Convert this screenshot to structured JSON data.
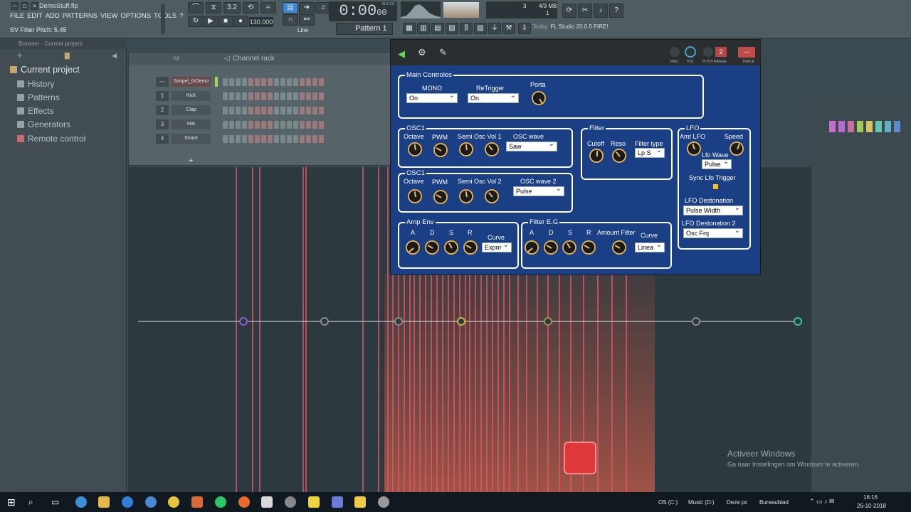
{
  "window": {
    "title": "DemoStuff.flp",
    "hint": "SV Filter Pitch: 5.45"
  },
  "menu": [
    "FILE",
    "EDIT",
    "ADD",
    "PATTERNS",
    "VIEW",
    "OPTIONS",
    "TOOLS",
    "?"
  ],
  "transport": {
    "time": "0:00",
    "time_sub": "00",
    "time_unit": "M:S:CS",
    "tempo": "130.000",
    "snap": "Line",
    "pattern": "Pattern 1",
    "memory": "4/3 MB",
    "cpu_count": "3",
    "polyphony": "1",
    "step_label": "3.2"
  },
  "news": {
    "prefix": "Today",
    "text": "FL Studio 20.0.5 FIRE!"
  },
  "browser": {
    "breadcrumb": "Browser - Current project",
    "root": "Current project",
    "items": [
      "History",
      "Patterns",
      "Effects",
      "Generators",
      "Remote control"
    ]
  },
  "channel_rack": {
    "title": "Channel rack",
    "filter": "All",
    "add": "+",
    "channels": [
      {
        "num": "---",
        "name": "Simpel_thDemo"
      },
      {
        "num": "1",
        "name": "Kick"
      },
      {
        "num": "2",
        "name": "Clap"
      },
      {
        "num": "3",
        "name": "Hat"
      },
      {
        "num": "4",
        "name": "Snare"
      }
    ]
  },
  "plugin": {
    "header_labels": {
      "pan": "PAN",
      "vol": "VOL",
      "pitch": "PITCH",
      "range": "RANGE",
      "track": "TRACK",
      "range_value": "2",
      "track_value": "---"
    },
    "main": {
      "title": "Main Controles",
      "mono_label": "MONO",
      "mono_value": "On",
      "retrigger_label": "ReTrigger",
      "retrigger_value": "On",
      "porta_label": "Porta"
    },
    "osc1a": {
      "title": "OSC1",
      "octave": "Octave",
      "pwm": "PWM",
      "semi": "Semi",
      "vol": "Osc Vol 1",
      "wave_label": "OSC wave",
      "wave_value": "Saw"
    },
    "osc1b": {
      "title": "OSC1",
      "octave": "Octave",
      "pwm": "PWM",
      "semi": "Semi",
      "vol": "Osc Vol 2",
      "wave_label": "OSC wave 2",
      "wave_value": "Pulse"
    },
    "filter": {
      "title": "Filter",
      "cutoff": "Cutoff",
      "reso": "Reso",
      "type_label": "Filter type",
      "type_value": "Lp S"
    },
    "lfo": {
      "title": "LFO",
      "amt": "Amt LFO",
      "speed": "Speed",
      "wave_label": "Lfo Wave",
      "wave_value": "Pulse",
      "sync": "Sync Lfo Trigger",
      "dest_label": "LFO Destonation",
      "dest_value": "Pulse Width",
      "dest2_label": "LFO Destonation 2",
      "dest2_value": "Osc Frq"
    },
    "amp": {
      "title": "Amp Env",
      "a": "A",
      "d": "D",
      "s": "S",
      "r": "R",
      "curve_label": "Curve",
      "curve_value": "Expor"
    },
    "filt_eg": {
      "title": "Filter E.G",
      "a": "A",
      "d": "D",
      "s": "S",
      "r": "R",
      "amount": "Amount Filter",
      "curve_label": "Curve",
      "curve_value": "Linea"
    }
  },
  "watermark": {
    "title": "Activeer Windows",
    "sub": "Ga naar Instellingen om Windows te activeren."
  },
  "taskbar": {
    "drive1": "OS (C:)",
    "drive2": "Music (D:)",
    "pc": "Deze pc",
    "desktop": "Bureaublad",
    "time": "16:16",
    "date": "26-10-2018"
  },
  "colors": {
    "plugin_bg": "#1a3f85",
    "knob_ring": "#e0b04e",
    "stage_bg": "#2c3a3f"
  }
}
